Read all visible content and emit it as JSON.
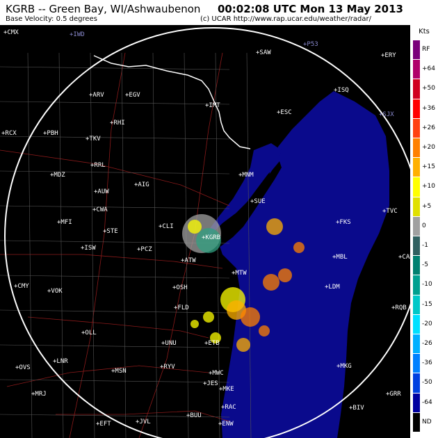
{
  "header": {
    "station": "KGRB -- Green Bay, WI/Ashwaubenon",
    "time": "00:02:08 UTC Mon 13 May 2013",
    "product": "Base Velocity: 0.5 degrees",
    "credit": "(c) UCAR  http://www.rap.ucar.edu/weather/radar/"
  },
  "legend": {
    "title": "Kts",
    "entries": [
      {
        "label": "RF",
        "color": "#7a007a"
      },
      {
        "label": "+64",
        "color": "#b0006a"
      },
      {
        "label": "+50",
        "color": "#d00020"
      },
      {
        "label": "+36",
        "color": "#ff0000"
      },
      {
        "label": "+26",
        "color": "#ff4010"
      },
      {
        "label": "+20",
        "color": "#ff8000"
      },
      {
        "label": "+15",
        "color": "#ffb000"
      },
      {
        "label": "+10",
        "color": "#ffff00"
      },
      {
        "label": "+5",
        "color": "#e0e000"
      },
      {
        "label": "0",
        "color": "#a0a0a0"
      },
      {
        "label": "-1",
        "color": "#306060"
      },
      {
        "label": "-5",
        "color": "#008070"
      },
      {
        "label": "-10",
        "color": "#00a090"
      },
      {
        "label": "-15",
        "color": "#00c8c8"
      },
      {
        "label": "-20",
        "color": "#00e0ff"
      },
      {
        "label": "-26",
        "color": "#00b0ff"
      },
      {
        "label": "-36",
        "color": "#0080ff"
      },
      {
        "label": "-50",
        "color": "#0040e0"
      },
      {
        "label": "-64",
        "color": "#0000a0"
      },
      {
        "label": "ND",
        "color": "#000000"
      }
    ]
  },
  "lake_color": "#0a0a8c",
  "cities": [
    {
      "name": "IWD",
      "dim": true
    },
    {
      "name": "SAW"
    },
    {
      "name": "P53",
      "dim": true
    },
    {
      "name": "ERY"
    },
    {
      "name": "CMX"
    },
    {
      "name": "PBH"
    },
    {
      "name": "ARV"
    },
    {
      "name": "EGV"
    },
    {
      "name": "RHI"
    },
    {
      "name": "TKV"
    },
    {
      "name": "IMT"
    },
    {
      "name": "ESC"
    },
    {
      "name": "ISQ"
    },
    {
      "name": "SJX",
      "dim": true
    },
    {
      "name": "RCX"
    },
    {
      "name": "RRL"
    },
    {
      "name": "MDZ"
    },
    {
      "name": "AIG"
    },
    {
      "name": "MNM"
    },
    {
      "name": "AUW"
    },
    {
      "name": "CWA"
    },
    {
      "name": "SUE"
    },
    {
      "name": "TVC"
    },
    {
      "name": "MFI"
    },
    {
      "name": "STE"
    },
    {
      "name": "CLI"
    },
    {
      "name": "FKS"
    },
    {
      "name": "ISW"
    },
    {
      "name": "PCZ"
    },
    {
      "name": "KGRB"
    },
    {
      "name": "MBL"
    },
    {
      "name": "CAD"
    },
    {
      "name": "ATW"
    },
    {
      "name": "MTW"
    },
    {
      "name": "CMY"
    },
    {
      "name": "VOK"
    },
    {
      "name": "OSH"
    },
    {
      "name": "LDM"
    },
    {
      "name": "FLD"
    },
    {
      "name": "RQB"
    },
    {
      "name": "OLL"
    },
    {
      "name": "UNU"
    },
    {
      "name": "ETB"
    },
    {
      "name": "OVS"
    },
    {
      "name": "LNR"
    },
    {
      "name": "MSN"
    },
    {
      "name": "RYV"
    },
    {
      "name": "MWC"
    },
    {
      "name": "MKG"
    },
    {
      "name": "JES"
    },
    {
      "name": "MRJ"
    },
    {
      "name": "MKE"
    },
    {
      "name": "GRR"
    },
    {
      "name": "RAC"
    },
    {
      "name": "BIV"
    },
    {
      "name": "EFT"
    },
    {
      "name": "JVL"
    },
    {
      "name": "BUU"
    },
    {
      "name": "ENW"
    }
  ]
}
